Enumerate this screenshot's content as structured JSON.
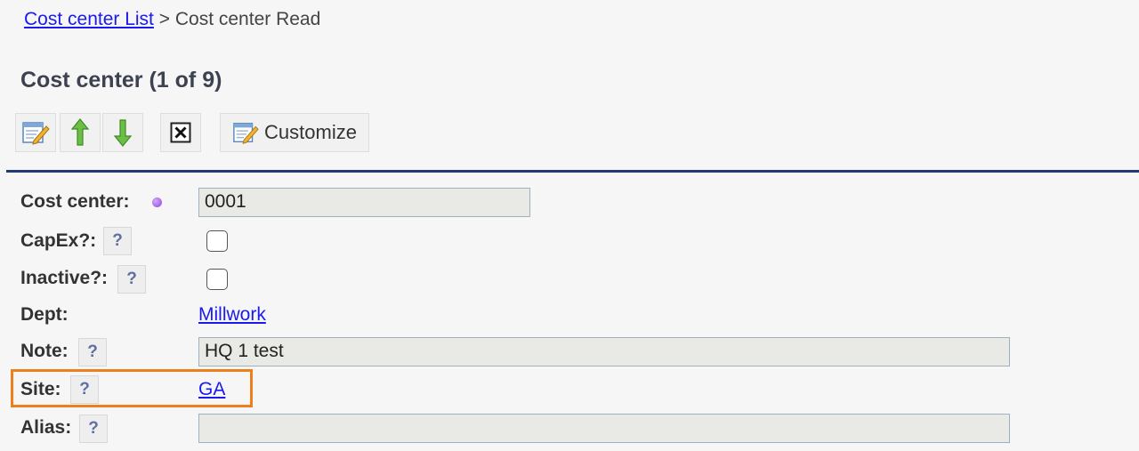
{
  "breadcrumb": {
    "link_label": "Cost center List",
    "separator": ">",
    "current": "Cost center Read"
  },
  "page_title": "Cost center (1 of 9)",
  "toolbar": {
    "edit_icon": "edit-icon",
    "prev_icon": "arrow-up-icon",
    "next_icon": "arrow-down-icon",
    "delete_icon": "close-box-icon",
    "customize_label": "Customize"
  },
  "fields": {
    "cost_center": {
      "label": "Cost center:",
      "value": "0001"
    },
    "capex": {
      "label": "CapEx?:",
      "checked": false
    },
    "inactive": {
      "label": "Inactive?:",
      "checked": false
    },
    "dept": {
      "label": "Dept:",
      "value": "Millwork"
    },
    "note": {
      "label": "Note:",
      "value": "HQ 1 test"
    },
    "site": {
      "label": "Site:",
      "value": "GA"
    },
    "alias": {
      "label": "Alias:",
      "value": ""
    }
  },
  "help_label": "?",
  "colors": {
    "link": "#1a1aee",
    "divider": "#223a72",
    "highlight": "#ee7f1d",
    "required_dot": "#8e44d8",
    "up_arrow": "#5cae3c",
    "down_arrow": "#5cae3c"
  }
}
